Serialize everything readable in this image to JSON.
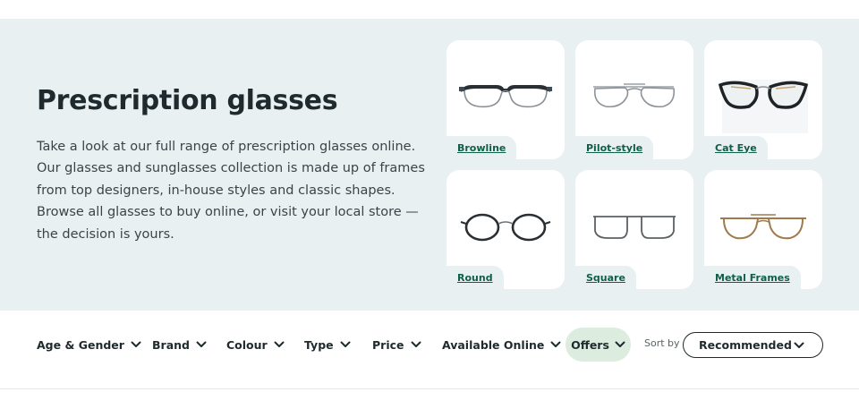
{
  "hero": {
    "title": "Prescription glasses",
    "description": "Take a look at our full range of prescription glasses online. Our glasses and sunglasses collection is made up of frames from top designers, in-house styles and classic shapes. Browse all glasses to buy online, or visit your local store — the decision is yours."
  },
  "categories": [
    {
      "label": "Browline",
      "icon": "browline-glasses-icon"
    },
    {
      "label": "Pilot-style",
      "icon": "pilot-glasses-icon"
    },
    {
      "label": "Cat Eye",
      "icon": "cat-eye-glasses-icon"
    },
    {
      "label": "Round",
      "icon": "round-glasses-icon"
    },
    {
      "label": "Square",
      "icon": "square-glasses-icon"
    },
    {
      "label": "Metal Frames",
      "icon": "metal-frame-glasses-icon"
    }
  ],
  "filters": [
    {
      "label": "Age & Gender"
    },
    {
      "label": "Brand"
    },
    {
      "label": "Colour"
    },
    {
      "label": "Type"
    },
    {
      "label": "Price"
    },
    {
      "label": "Available Online"
    }
  ],
  "offers": {
    "label": "Offers"
  },
  "sort": {
    "label": "Sort by",
    "value": "Recommended"
  },
  "colors": {
    "hero_bg": "#e9f0f2",
    "link_green": "#0f5f45",
    "offers_bg": "#dcecdf"
  }
}
